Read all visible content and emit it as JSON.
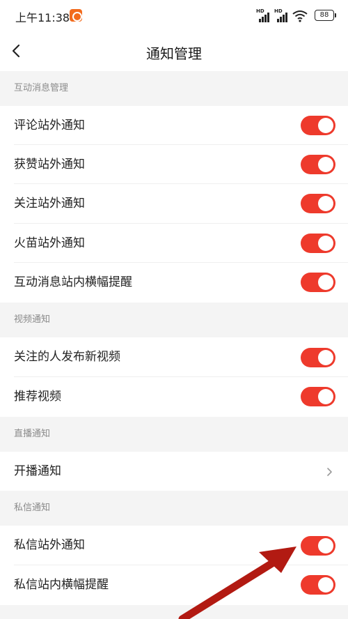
{
  "status_bar": {
    "time": "上午11:38",
    "battery": "88",
    "signal_labels": [
      "HD",
      "HD"
    ]
  },
  "header": {
    "title": "通知管理"
  },
  "sections": [
    {
      "title": "互动消息管理",
      "rows": [
        {
          "label": "评论站外通知",
          "type": "toggle",
          "on": true
        },
        {
          "label": "获赞站外通知",
          "type": "toggle",
          "on": true
        },
        {
          "label": "关注站外通知",
          "type": "toggle",
          "on": true
        },
        {
          "label": "火苗站外通知",
          "type": "toggle",
          "on": true
        },
        {
          "label": "互动消息站内横幅提醒",
          "type": "toggle",
          "on": true
        }
      ]
    },
    {
      "title": "视频通知",
      "rows": [
        {
          "label": "关注的人发布新视频",
          "type": "toggle",
          "on": true
        },
        {
          "label": "推荐视频",
          "type": "toggle",
          "on": true
        }
      ]
    },
    {
      "title": "直播通知",
      "rows": [
        {
          "label": "开播通知",
          "type": "link"
        }
      ]
    },
    {
      "title": "私信通知",
      "rows": [
        {
          "label": "私信站外通知",
          "type": "toggle",
          "on": true
        },
        {
          "label": "私信站内横幅提醒",
          "type": "toggle",
          "on": true
        }
      ]
    }
  ],
  "colors": {
    "toggle_on": "#ee3a2c",
    "annotation_arrow": "#b21a12",
    "section_bg": "#f4f4f4"
  }
}
